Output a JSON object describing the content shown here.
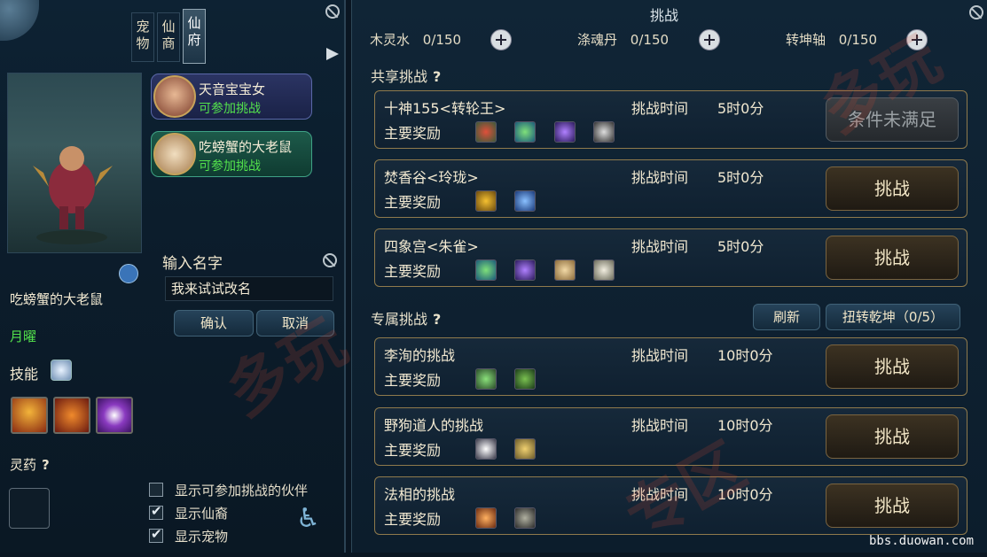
{
  "left": {
    "tabs": [
      "宠物",
      "仙商",
      "仙府"
    ],
    "partners": [
      {
        "name": "天音宝宝女",
        "status": "可参加挑战"
      },
      {
        "name": "吃螃蟹的大老鼠",
        "status": "可参加挑战"
      }
    ],
    "character_name": "吃螃蟹的大老鼠",
    "title": "月曜",
    "skills_label": "技能",
    "herb_label": "灵药",
    "herb_help": "?",
    "rename": {
      "label": "输入名字",
      "value": "我来试试改名",
      "confirm": "确认",
      "cancel": "取消"
    },
    "checkboxes": [
      {
        "label": "显示可参加挑战的伙伴",
        "checked": false
      },
      {
        "label": "显示仙裔",
        "checked": true
      },
      {
        "label": "显示宠物",
        "checked": true
      }
    ]
  },
  "right": {
    "title": "挑战",
    "resources": [
      {
        "name": "木灵水",
        "count": "0/150"
      },
      {
        "name": "涤魂丹",
        "count": "0/150"
      },
      {
        "name": "转坤轴",
        "count": "0/150"
      }
    ],
    "shared_title": "共享挑战",
    "exclusive_title": "专属挑战",
    "help": "?",
    "refresh": "刷新",
    "twist": "扭转乾坤（0/5）",
    "time_label": "挑战时间",
    "reward_label": "主要奖励",
    "shared": [
      {
        "name": "十神155<转轮王>",
        "time": "5时0分",
        "button": "条件未满足",
        "disabled": true
      },
      {
        "name": "焚香谷<玲珑>",
        "time": "5时0分",
        "button": "挑战",
        "disabled": false
      },
      {
        "name": "四象宫<朱雀>",
        "time": "5时0分",
        "button": "挑战",
        "disabled": false
      }
    ],
    "exclusive": [
      {
        "name": "李洵的挑战",
        "time": "10时0分",
        "button": "挑战",
        "disabled": false
      },
      {
        "name": "野狗道人的挑战",
        "time": "10时0分",
        "button": "挑战",
        "disabled": false
      },
      {
        "name": "法相的挑战",
        "time": "10时0分",
        "button": "挑战",
        "disabled": false
      }
    ]
  },
  "watermark": "bbs.duowan.com"
}
